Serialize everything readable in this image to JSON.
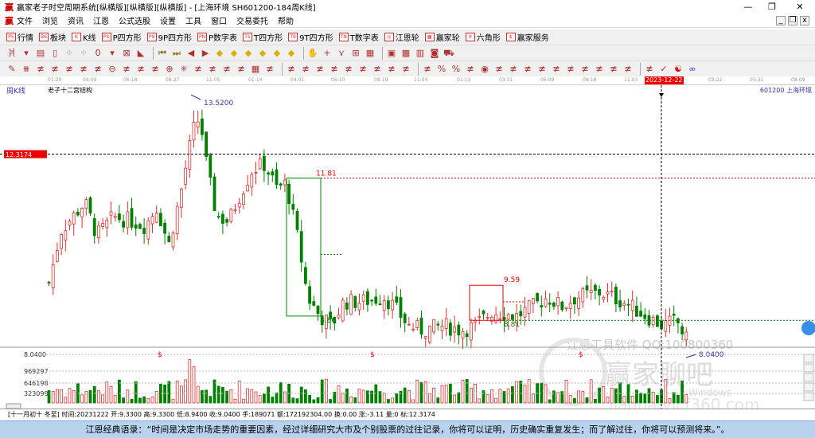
{
  "window": {
    "logo": "赢",
    "title": "赢家老子时空周期系统[纵横版][纵横版][纵横版] - [上海环境  SH601200-184周K线]",
    "min": "—",
    "max": "❐",
    "close": "✕"
  },
  "menu": {
    "logo": "赢",
    "items": [
      "文件",
      "浏览",
      "资讯",
      "江恩",
      "公式选股",
      "设置",
      "工具",
      "窗口",
      "交易委托",
      "帮助"
    ],
    "mdi": [
      "_",
      "❐",
      "x"
    ]
  },
  "toolbar1": [
    {
      "icon": "PS",
      "label": "行情"
    },
    {
      "icon": "BK",
      "label": "板块"
    },
    {
      "icon": "K",
      "label": "K线"
    },
    {
      "icon": "PS",
      "label": "P四方形"
    },
    {
      "icon": "P9",
      "label": "9P四方形"
    },
    {
      "icon": "PN",
      "label": "P数字表"
    },
    {
      "icon": "TS",
      "label": "T四方形"
    },
    {
      "icon": "T9",
      "label": "9T四方形"
    },
    {
      "icon": "TN",
      "label": "T数字表"
    },
    {
      "icon": "◎",
      "label": "江恩轮"
    },
    {
      "icon": "▦",
      "label": "赢家轮"
    },
    {
      "icon": "✡",
      "label": "六角形"
    },
    {
      "icon": "$",
      "label": "赢家服务"
    }
  ],
  "toolbar2": [
    "period-icon",
    "▾",
    "chart-icon",
    "doc-icon",
    "scatter-icon",
    "scatter2-icon",
    "0",
    "▾",
    "cancel-icon",
    "color-icon",
    "|",
    "first-icon",
    "last-icon",
    "prev-icon",
    "next-icon",
    "diamond1-icon",
    "diamond2-icon",
    "diamond3-icon",
    "diamond4-icon",
    "diamond5-icon",
    "diamond6-icon",
    "|",
    "hand-icon",
    "cross-icon",
    "line-icon",
    "gift-icon",
    "grid-icon",
    "|",
    "calendar-icon",
    "calc-icon",
    "book-icon",
    "save-icon",
    "truck-icon"
  ],
  "toolbar3": [
    "pen-icon",
    "lines-icon",
    "fan-icon",
    "fan2-icon",
    "fib-icon",
    "spiral-icon",
    "arrow-icon",
    "circle-icon",
    "bars-icon",
    "n2-icon",
    "triangle-icon",
    "target-icon",
    "star-icon",
    "box-icon",
    "angle-icon",
    "speed-icon",
    "speed2-icon",
    "grid-icon",
    "span-icon",
    "|",
    "cycle-icon",
    "fan3-icon",
    "box2-icon",
    "box3-icon",
    "angle2-icon",
    "v-icon",
    "grid2-icon",
    "grid3-icon",
    "wave-icon",
    "|",
    "table-icon",
    "percent-icon",
    "%",
    "pct2-icon",
    "coin-icon",
    "gold-icon",
    "arrow2-icon",
    "fib2-icon",
    "gold2-icon",
    "angle3-icon",
    "e-icon",
    "angle4-icon",
    "speed3-icon",
    "speed4-icon",
    "angle5-icon",
    "|",
    "grid4-icon",
    "check-icon",
    "yinyang-icon",
    "infinity-icon"
  ],
  "dates": [
    [
      "01-29",
      68
    ],
    [
      "04-09",
      112
    ],
    [
      "06-18",
      163
    ],
    [
      "08-27",
      216
    ],
    [
      "11-05",
      267
    ],
    [
      "01-14",
      320
    ],
    [
      "04-01",
      373
    ],
    [
      "06-10",
      424
    ],
    [
      "08-19",
      478
    ],
    [
      "11-04",
      528
    ],
    [
      "01-13",
      582
    ],
    [
      "03-31",
      635
    ],
    [
      "06-09",
      687
    ],
    [
      "08-18",
      740
    ],
    [
      "11-03",
      792
    ],
    [
      "03-22",
      898
    ],
    [
      "05-31",
      950
    ],
    [
      "08-09",
      1002
    ]
  ],
  "current_date": "2023-12-22",
  "chart": {
    "period_label": "周K线",
    "indicator": "老子十二宫结构",
    "stock": "601200 上海环境",
    "cursor_price": "12.3174",
    "high": "13.5200",
    "low": "8.0400",
    "box1_top": "11.81",
    "box1_bottom": "8.86",
    "box2_top": "9.59",
    "box2_bottom": "8.81",
    "vol_axis": [
      "8.0400",
      "969297",
      "646198",
      "323099"
    ],
    "marker": "$",
    "watermark1": "江恩工具软件  QQ:100800360",
    "watermark2": "赢家聊吧",
    "watermark3": "liaoba.yjcf360.com",
    "watermark4": "Windows",
    "price_path": [
      [
        0,
        9.6
      ],
      [
        5,
        10.7
      ],
      [
        10,
        11.0
      ],
      [
        15,
        11.3
      ],
      [
        20,
        10.6
      ],
      [
        27,
        11.0
      ],
      [
        35,
        10.9
      ],
      [
        40,
        10.8
      ],
      [
        45,
        11.2
      ],
      [
        50,
        10.4
      ],
      [
        55,
        11.5
      ],
      [
        60,
        12.8
      ],
      [
        63,
        13.1
      ],
      [
        66,
        12.0
      ],
      [
        70,
        11.0
      ],
      [
        75,
        10.9
      ],
      [
        80,
        11.5
      ],
      [
        85,
        12.0
      ],
      [
        90,
        12.1
      ],
      [
        95,
        11.6
      ],
      [
        99,
        11.7
      ],
      [
        104,
        10.5
      ],
      [
        108,
        9.3
      ],
      [
        113,
        8.9
      ],
      [
        118,
        8.7
      ],
      [
        123,
        9.2
      ],
      [
        130,
        9.2
      ],
      [
        140,
        9.3
      ],
      [
        144,
        9.1
      ],
      [
        150,
        8.7
      ],
      [
        156,
        8.6
      ],
      [
        165,
        8.7
      ],
      [
        172,
        8.6
      ],
      [
        178,
        8.7
      ],
      [
        185,
        9.0
      ],
      [
        195,
        8.9
      ],
      [
        202,
        9.1
      ],
      [
        208,
        9.3
      ],
      [
        214,
        9.1
      ],
      [
        220,
        9.3
      ],
      [
        230,
        9.4
      ],
      [
        240,
        9.2
      ],
      [
        246,
        9.0
      ],
      [
        256,
        8.7
      ],
      [
        262,
        8.8
      ],
      [
        266,
        8.4
      ]
    ]
  },
  "status": "[十一月初十 冬至] 时间:20231222 开:9.3300 高:9.3300 低:8.9400 收:9.0400 手:189071 额:172192304.00 换:0.00 涨:-3.11 量:0 标:12.3174",
  "quote": "江恩经典语录：“时间是决定市场走势的重要因素，经过详细研究大市及个别股票的过往记录，你将可以证明，历史确实重复发生；而了解过往，你将可以预测将来。”。",
  "colors": {
    "up": "#e03030",
    "down": "#008000",
    "accent": "#e00000",
    "blue": "#3333aa"
  }
}
